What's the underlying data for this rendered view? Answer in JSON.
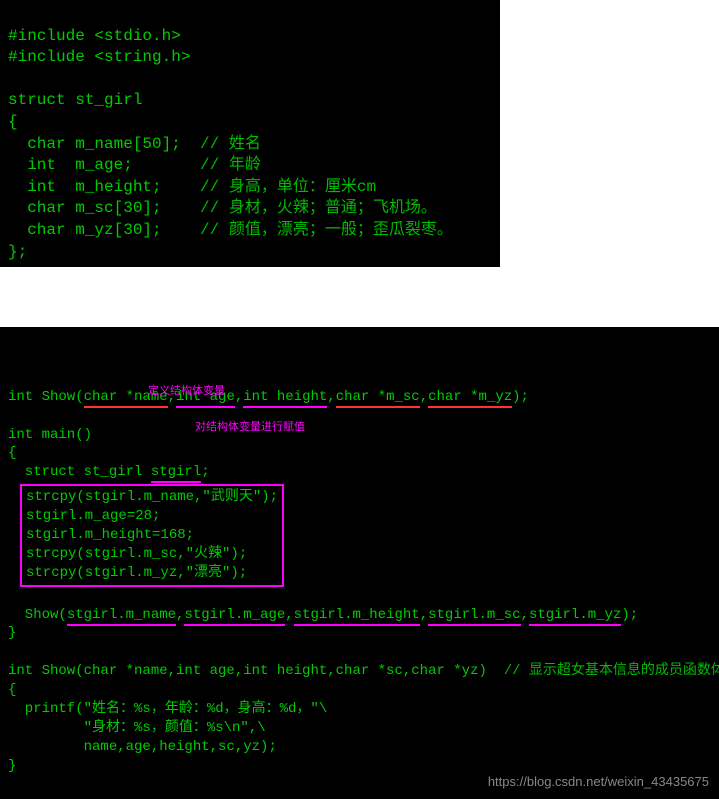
{
  "block1": {
    "lines": {
      "l1": "#include <stdio.h>",
      "l2": "#include <string.h>",
      "l3": "",
      "l4": "struct st_girl",
      "l5": "{",
      "l6a": "  char m_name[50];  ",
      "l6b": "// 姓名",
      "l7a": "  int  m_age;       ",
      "l7b": "// 年龄",
      "l8a": "  int  m_height;    ",
      "l8b": "// 身高，单位：厘米cm",
      "l9a": "  char m_sc[30];    ",
      "l9b": "// 身材，火辣；普通；飞机场。",
      "l10a": "  char m_yz[30];    ",
      "l10b": "// 颜值，漂亮；一般；歪瓜裂枣。",
      "l11": "};"
    }
  },
  "block2": {
    "lines": {
      "p1a": "int Show(",
      "p1_char_name": "char *name",
      "p1_comma1": ",",
      "p1_int_age": "int age",
      "p1_comma2": ",",
      "p1_int_height": "int height",
      "p1_comma3": ",",
      "p1_char_msc": "char *m_sc",
      "p1_comma4": ",",
      "p1_char_myz": "char *m_yz",
      "p1_end": ");",
      "p2": "",
      "p3": "int main()",
      "p4": "{",
      "p5a": "  struct st_girl ",
      "p5_stgirl": "stgirl",
      "p5b": ";",
      "box1": "strcpy(stgirl.m_name,\"武则天\");",
      "box2": "stgirl.m_age=28;",
      "box3": "stgirl.m_height=168;",
      "box4": "strcpy(stgirl.m_sc,\"火辣\");",
      "box5": "strcpy(stgirl.m_yz,\"漂亮\");",
      "s1a": "  Show(",
      "s1_name": "stgirl.m_name",
      "s1_c1": ",",
      "s1_age": "stgirl.m_age",
      "s1_c2": ",",
      "s1_height": "stgirl.m_height",
      "s1_c3": ",",
      "s1_sc": "stgirl.m_sc",
      "s1_c4": ",",
      "s1_yz": "stgirl.m_yz",
      "s1_end": ");",
      "s2": "}",
      "s3": "",
      "f1a": "int Show(char *name,int age,int height,char *sc,char *yz)  ",
      "f1b": "// 显示超女基本信息的成员函数体",
      "f2": "{",
      "f3": "  printf(\"姓名：%s，年龄：%d，身高：%d，\"\\",
      "f4": "         \"身材：%s，颜值：%s\\n\",\\",
      "f5": "         name,age,height,sc,yz);",
      "f6": "}"
    },
    "annotations": {
      "a1": "定义结构体变量",
      "a2": "对结构体变量进行赋值"
    }
  },
  "watermark": "https://blog.csdn.net/weixin_43435675"
}
